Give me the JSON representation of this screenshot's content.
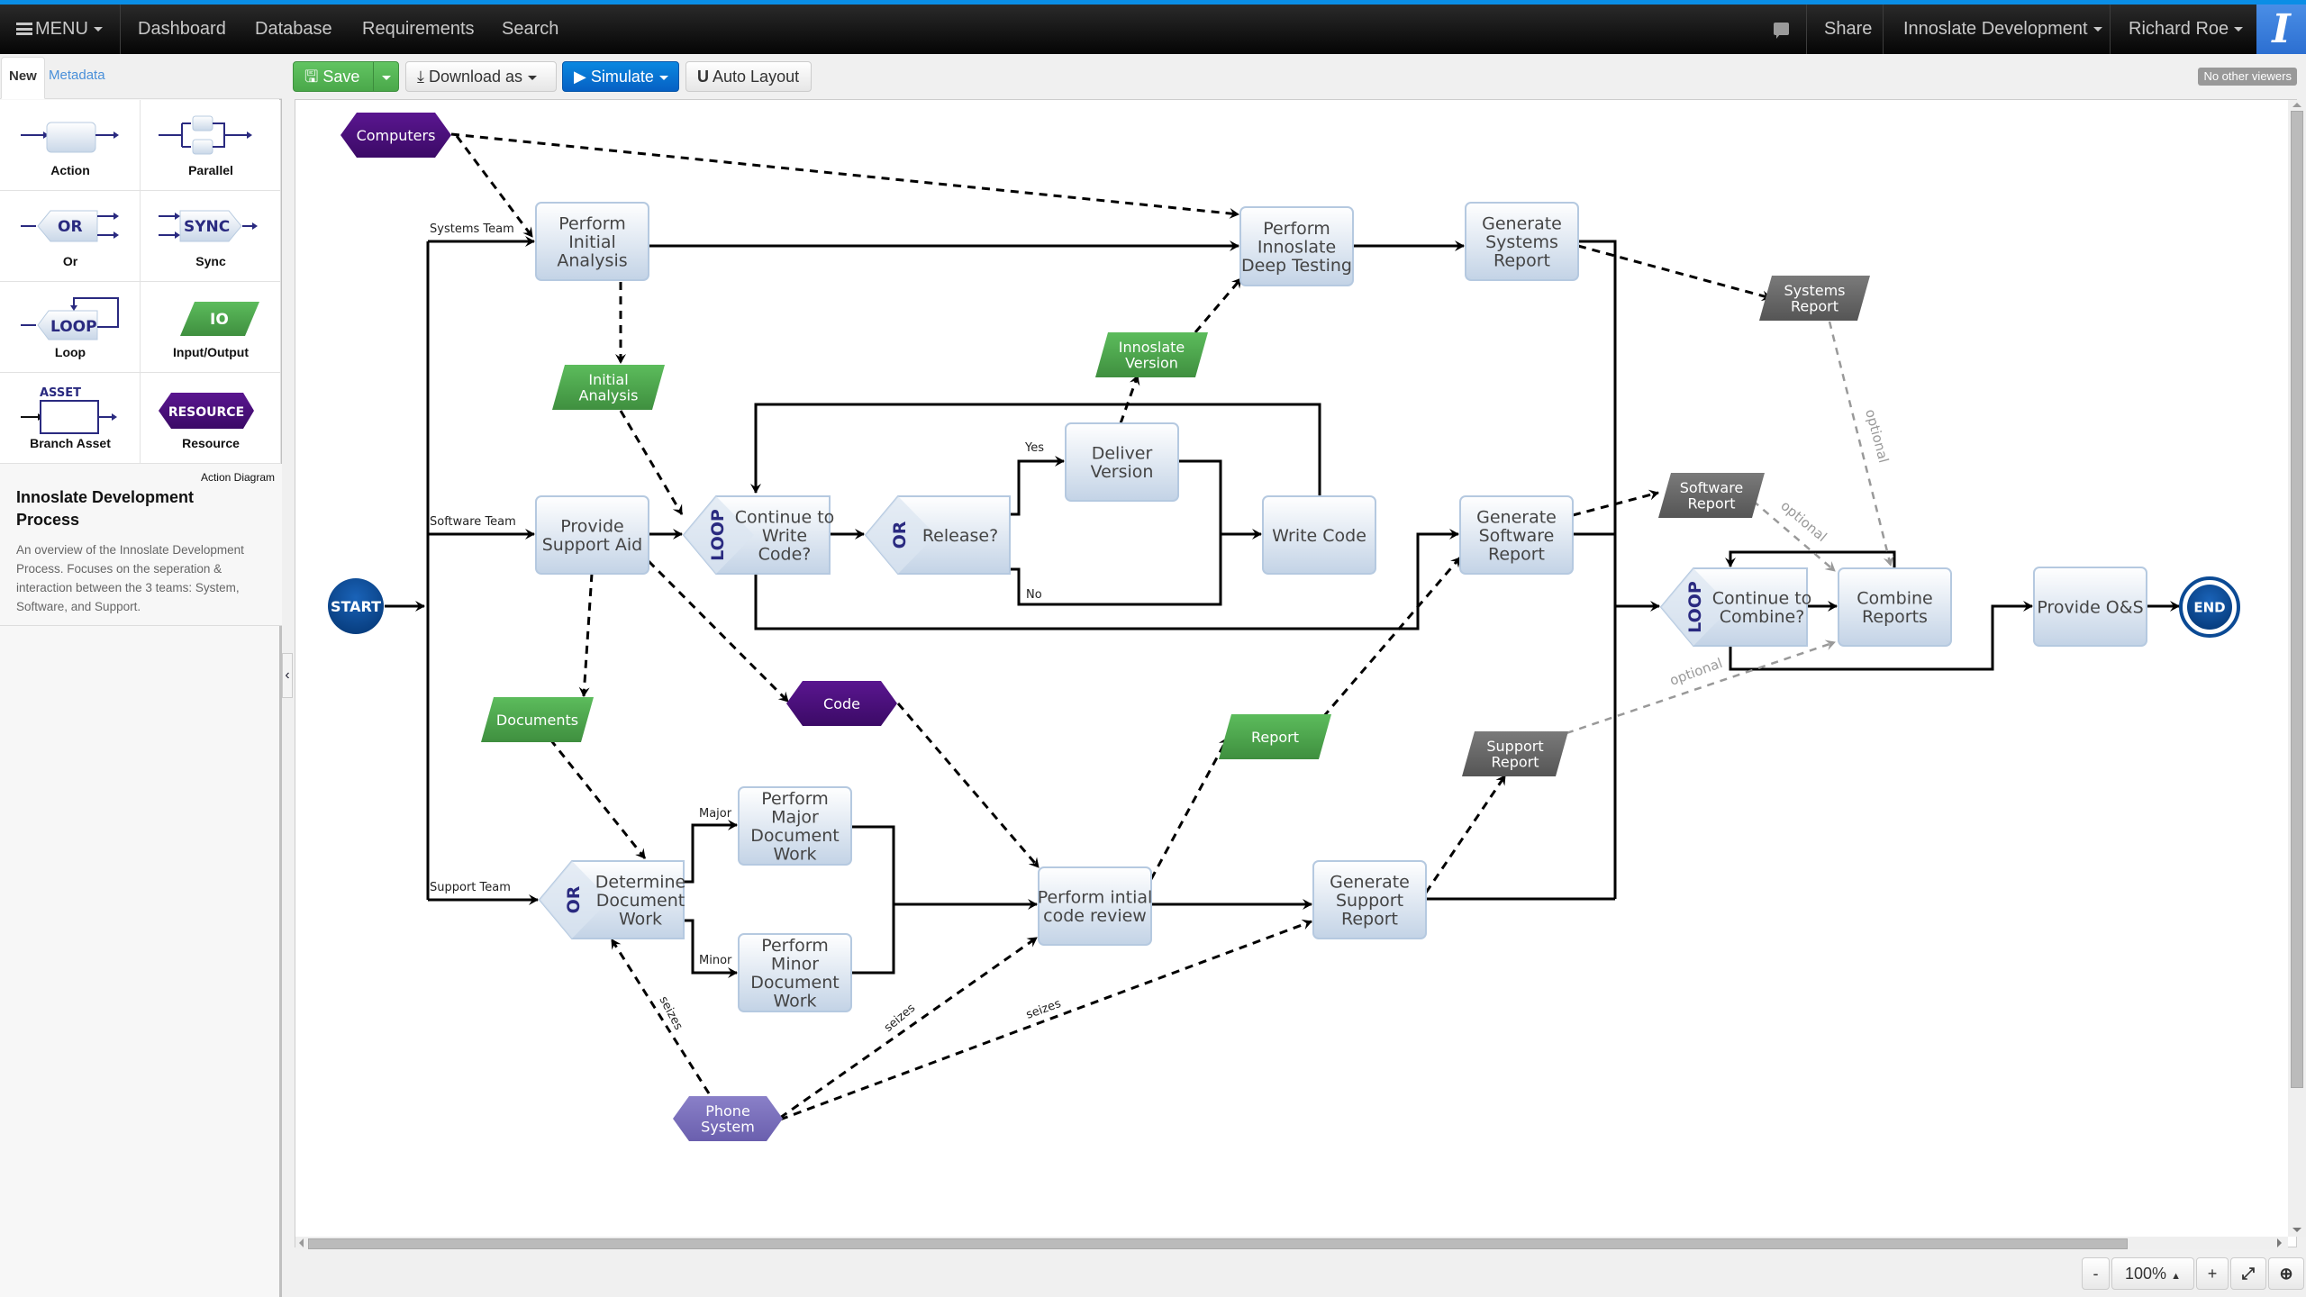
{
  "navbar": {
    "menu": "MENU",
    "links": [
      "Dashboard",
      "Database",
      "Requirements",
      "Search"
    ],
    "share": "Share",
    "project": "Innoslate Development",
    "user": "Richard Roe",
    "logo": "I"
  },
  "sidebar": {
    "tabs": [
      "New",
      "Metadata"
    ],
    "palette": [
      {
        "label": "Action",
        "icon": "action-icon"
      },
      {
        "label": "Parallel",
        "icon": "parallel-icon"
      },
      {
        "label": "Or",
        "icon": "or-icon",
        "glyph": "OR"
      },
      {
        "label": "Sync",
        "icon": "sync-icon",
        "glyph": "SYNC"
      },
      {
        "label": "Loop",
        "icon": "loop-icon",
        "glyph": "LOOP"
      },
      {
        "label": "Input/Output",
        "icon": "io-icon",
        "glyph": "IO"
      },
      {
        "label": "Branch Asset",
        "icon": "branch-asset-icon",
        "glyph": "ASSET"
      },
      {
        "label": "Resource",
        "icon": "resource-icon",
        "glyph": "RESOURCE"
      }
    ],
    "info": {
      "type": "Action Diagram",
      "title": "Innoslate Development Process",
      "description": "An overview of the Innoslate Development Process. Focuses on the seperation & interaction between the 3 teams: System, Software, and Support."
    }
  },
  "toolbar": {
    "save": "Save",
    "download": "Download as",
    "simulate": "Simulate",
    "auto_layout": "Auto Layout",
    "viewers": "No other viewers"
  },
  "zoom": {
    "minus": "-",
    "level": "100%",
    "plus": "+"
  },
  "colors": {
    "accent": "#0a8ee6",
    "io_green": "#4caf50",
    "resource_purple": "#4b0f7a",
    "phone_purple": "#7b6fb8",
    "output_gray": "#6b6b6b",
    "start_blue": "#0b4a94"
  },
  "diagram": {
    "start": "START",
    "end": "END",
    "branch_labels": {
      "systems": "Systems Team",
      "software": "Software Team",
      "support": "Support Team",
      "yes": "Yes",
      "no": "No",
      "major": "Major",
      "minor": "Minor"
    },
    "actions": {
      "perform_initial_analysis": [
        "Perform",
        "Initial",
        "Analysis"
      ],
      "perform_deep_testing": [
        "Perform",
        "Innoslate",
        "Deep Testing"
      ],
      "generate_systems_report": [
        "Generate",
        "Systems",
        "Report"
      ],
      "provide_support_aid": [
        "Provide",
        "Support Aid"
      ],
      "deliver_version": [
        "Deliver",
        "Version"
      ],
      "write_code": [
        "Write Code"
      ],
      "generate_software_report": [
        "Generate",
        "Software",
        "Report"
      ],
      "combine_reports": [
        "Combine",
        "Reports"
      ],
      "provide_os": [
        "Provide O&S"
      ],
      "perform_major_doc": [
        "Perform",
        "Major",
        "Document",
        "Work"
      ],
      "perform_minor_doc": [
        "Perform",
        "Minor",
        "Document",
        "Work"
      ],
      "perform_code_review": [
        "Perform intial",
        "code review"
      ],
      "generate_support_report": [
        "Generate",
        "Support",
        "Report"
      ]
    },
    "decisions": {
      "continue_write_code": {
        "glyph": "LOOP",
        "lines": [
          "Continue to",
          "Write",
          "Code?"
        ]
      },
      "release": {
        "glyph": "OR",
        "lines": [
          "Release?"
        ]
      },
      "continue_combine": {
        "glyph": "LOOP",
        "lines": [
          "Continue to",
          "Combine?"
        ]
      },
      "determine_doc_work": {
        "glyph": "OR",
        "lines": [
          "Determine",
          "Document",
          "Work"
        ]
      }
    },
    "io": {
      "initial_analysis": [
        "Initial",
        "Analysis"
      ],
      "innoslate_version": [
        "Innoslate",
        "Version"
      ],
      "documents": [
        "Documents"
      ],
      "report": [
        "Report"
      ],
      "systems_report": [
        "Systems",
        "Report"
      ],
      "software_report": [
        "Software",
        "Report"
      ],
      "support_report": [
        "Support",
        "Report"
      ]
    },
    "resources": {
      "computers": [
        "Computers"
      ],
      "code": [
        "Code"
      ],
      "phone_system": [
        "Phone",
        "System"
      ]
    },
    "edge_labels": {
      "optional": "optional",
      "seizes": "seizes"
    }
  }
}
